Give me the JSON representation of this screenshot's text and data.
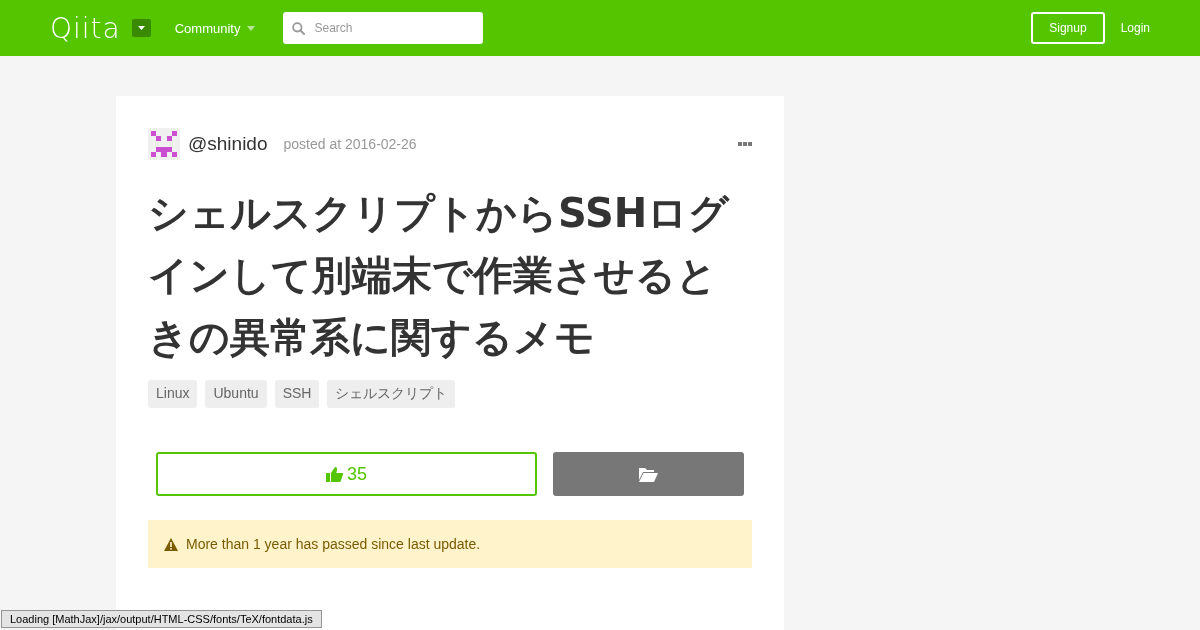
{
  "header": {
    "logo": "Qiita",
    "community": "Community",
    "search": {
      "placeholder": "Search"
    },
    "signup": "Signup",
    "login": "Login"
  },
  "article": {
    "author": "@shinido",
    "posted": "posted at 2016-02-26",
    "title": "シェルスクリプトからSSHログインして別端末で作業させるときの異常系に関するメモ",
    "tags": [
      "Linux",
      "Ubuntu",
      "SSH",
      "シェルスクリプト"
    ],
    "like": {
      "count": "35"
    },
    "alert": "More than 1 year has passed since last update."
  },
  "status_bar": "Loading [MathJax]/jax/output/HTML-CSS/fonts/TeX/fontdata.js"
}
